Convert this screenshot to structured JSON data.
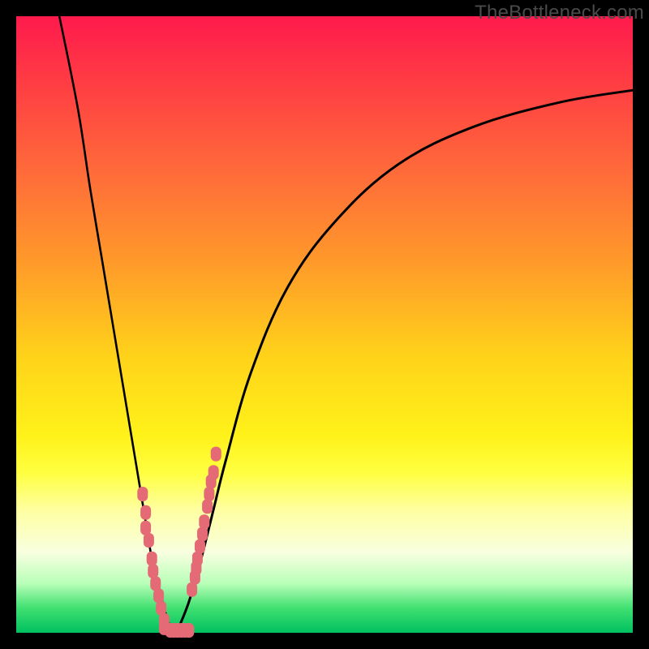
{
  "watermark": "TheBottleneck.com",
  "chart_data": {
    "type": "line",
    "title": "",
    "xlabel": "",
    "ylabel": "",
    "xlim": [
      0,
      100
    ],
    "ylim": [
      0,
      100
    ],
    "grid": false,
    "legend": "none",
    "background_gradient": {
      "top": "#ff1a4d",
      "upper_mid": "#ff9a2a",
      "mid": "#fff21a",
      "lower": "#00c060"
    },
    "series": [
      {
        "name": "curve-left",
        "x": [
          7,
          10,
          12,
          14,
          16,
          18,
          19,
          20,
          21,
          22,
          23,
          24,
          25,
          26
        ],
        "y": [
          100,
          85,
          72,
          60,
          48,
          36,
          30,
          24,
          18,
          12,
          8,
          4,
          1,
          0
        ]
      },
      {
        "name": "curve-right",
        "x": [
          26,
          28,
          30,
          32,
          34,
          38,
          44,
          52,
          62,
          74,
          88,
          100
        ],
        "y": [
          0,
          5,
          12,
          20,
          28,
          42,
          56,
          67,
          76,
          82,
          86,
          88
        ]
      },
      {
        "name": "bead-cluster-left",
        "x": [
          20.5,
          21.0,
          21.0,
          21.5,
          22.0,
          22.2,
          22.6,
          23.1,
          23.5,
          24.0,
          24.0
        ],
        "y": [
          22.5,
          19.5,
          17.0,
          15.0,
          12.0,
          10.0,
          8.0,
          6.0,
          4.0,
          2.0,
          0.8
        ]
      },
      {
        "name": "bead-cluster-right",
        "x": [
          28.5,
          29.0,
          29.2,
          29.4,
          29.8,
          30.2,
          30.5,
          31.0,
          31.3,
          31.6,
          32.0,
          32.4
        ],
        "y": [
          7.0,
          9.0,
          10.5,
          12.0,
          14.0,
          16.0,
          18.0,
          20.5,
          22.5,
          24.5,
          26.0,
          29.0
        ]
      },
      {
        "name": "bead-cluster-bottom",
        "x": [
          25.0,
          25.6,
          26.2,
          26.8,
          27.4,
          28.0
        ],
        "y": [
          0.4,
          0.4,
          0.4,
          0.4,
          0.4,
          0.4
        ]
      }
    ],
    "annotations": []
  },
  "colors": {
    "bead": "#e46a76",
    "curve": "#000000"
  }
}
